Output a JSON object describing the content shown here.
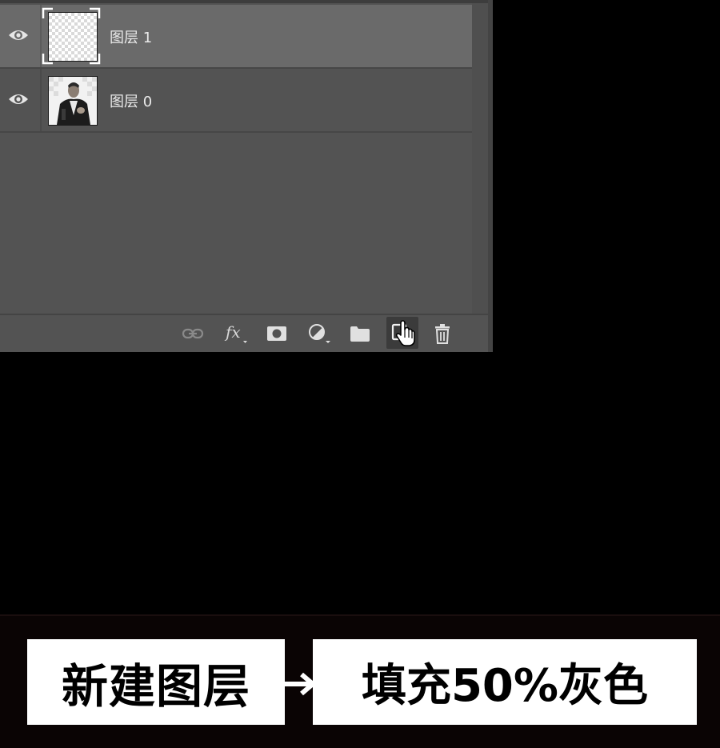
{
  "layers_panel": {
    "layers": [
      {
        "name": "图层 1",
        "selected": true,
        "visible": true,
        "thumbnail": "transparent-checkerboard"
      },
      {
        "name": "图层 0",
        "selected": false,
        "visible": true,
        "thumbnail": "portrait-photo"
      }
    ],
    "toolbar": [
      {
        "icon": "link-layers-icon"
      },
      {
        "icon": "fx-icon",
        "label": "fx"
      },
      {
        "icon": "add-mask-icon"
      },
      {
        "icon": "adjustment-layer-icon"
      },
      {
        "icon": "new-group-icon"
      },
      {
        "icon": "new-layer-icon",
        "state": "hovered-with-hand-cursor"
      },
      {
        "icon": "trash-icon"
      }
    ]
  },
  "caption": {
    "left": "新建图层",
    "arrow": "→",
    "right": "填充50%灰色"
  },
  "colors": {
    "panel_bg": "#535353",
    "selected_row_bg": "#6a6a6a",
    "page_bg": "#000000",
    "caption_box_bg": "#ffffff"
  }
}
